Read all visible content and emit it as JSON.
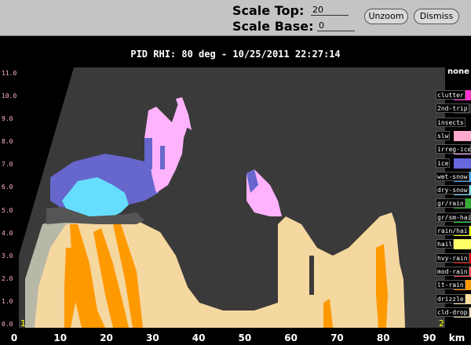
{
  "controls": {
    "scale_top_label": "Scale Top:",
    "scale_top_value": "20",
    "scale_base_label": "Scale Base:",
    "scale_base_value": "0",
    "unzoom_label": "Unzoom",
    "dismiss_label": "Dismiss"
  },
  "title": "PID  RHI: 80 deg  -  10/25/2011 22:27:14",
  "corner_left": "1",
  "corner_right": "2",
  "legend": {
    "title": "none",
    "items": [
      {
        "label": "clutter",
        "color": "#ff33cc"
      },
      {
        "label": "2nd-trip",
        "color": "#333333"
      },
      {
        "label": "insects",
        "color": "#000000"
      },
      {
        "label": "slw",
        "color": "#ffaacc"
      },
      {
        "label": "irreg-ice",
        "color": "#ffaaff"
      },
      {
        "label": "ice",
        "color": "#6666dd"
      },
      {
        "label": "wet-snow",
        "color": "#44aaff"
      },
      {
        "label": "dry-snow",
        "color": "#77ddff"
      },
      {
        "label": "gr/rain",
        "color": "#33aa33"
      },
      {
        "label": "gr/sm-hai",
        "color": "#33dd33"
      },
      {
        "label": "rain/hai",
        "color": "#ffff00"
      },
      {
        "label": "hail",
        "color": "#ffff66"
      },
      {
        "label": "hvy-rain",
        "color": "#dd0000"
      },
      {
        "label": "mod-rain",
        "color": "#ff5555"
      },
      {
        "label": "lt-rain",
        "color": "#ff9900"
      },
      {
        "label": "drizzle",
        "color": "#ffdda0"
      },
      {
        "label": "cld-drop",
        "color": "#f5deb3"
      }
    ]
  },
  "axes": {
    "y_ticks": [
      "0.0",
      "1.0",
      "2.0",
      "3.0",
      "4.0",
      "5.0",
      "6.0",
      "7.0",
      "8.0",
      "9.0",
      "10.0",
      "11.0"
    ],
    "x_ticks": [
      "0",
      "10",
      "20",
      "30",
      "40",
      "50",
      "60",
      "70",
      "80",
      "90"
    ],
    "x_unit": "km"
  },
  "colors": {
    "background_gray": "#3a3a3a",
    "lt_rain": "#ff9900",
    "drizzle": "#f5d7a0",
    "ice": "#6666cc",
    "dry_snow": "#66ddff",
    "irreg_ice": "#ffb3ff",
    "gray_band": "#b8b8a8"
  }
}
